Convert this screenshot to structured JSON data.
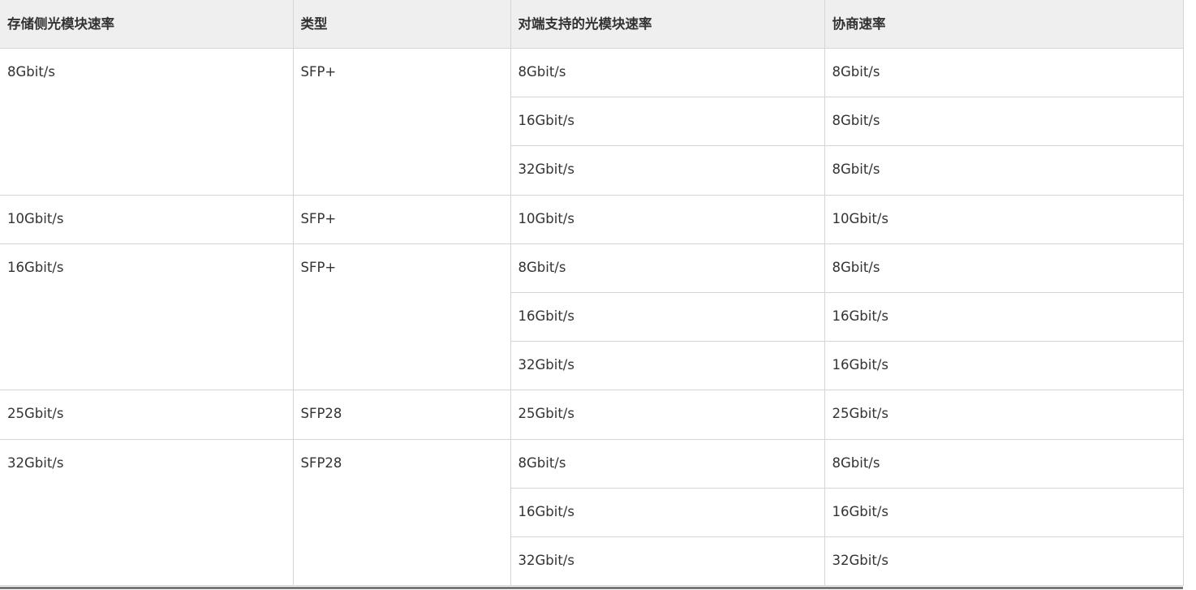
{
  "table": {
    "headers": [
      "存储侧光模块速率",
      "类型",
      "对端支持的光模块速率",
      "协商速率"
    ],
    "groups": [
      {
        "storage_rate": "8Gbit/s",
        "type": "SFP+",
        "rows": [
          {
            "peer_rate": "8Gbit/s",
            "negotiated": "8Gbit/s"
          },
          {
            "peer_rate": "16Gbit/s",
            "negotiated": "8Gbit/s"
          },
          {
            "peer_rate": "32Gbit/s",
            "negotiated": "8Gbit/s"
          }
        ]
      },
      {
        "storage_rate": "10Gbit/s",
        "type": "SFP+",
        "rows": [
          {
            "peer_rate": "10Gbit/s",
            "negotiated": "10Gbit/s"
          }
        ]
      },
      {
        "storage_rate": "16Gbit/s",
        "type": "SFP+",
        "rows": [
          {
            "peer_rate": "8Gbit/s",
            "negotiated": "8Gbit/s"
          },
          {
            "peer_rate": "16Gbit/s",
            "negotiated": "16Gbit/s"
          },
          {
            "peer_rate": "32Gbit/s",
            "negotiated": "16Gbit/s"
          }
        ]
      },
      {
        "storage_rate": "25Gbit/s",
        "type": "SFP28",
        "rows": [
          {
            "peer_rate": "25Gbit/s",
            "negotiated": "25Gbit/s"
          }
        ]
      },
      {
        "storage_rate": "32Gbit/s",
        "type": "SFP28",
        "rows": [
          {
            "peer_rate": "8Gbit/s",
            "negotiated": "8Gbit/s"
          },
          {
            "peer_rate": "16Gbit/s",
            "negotiated": "16Gbit/s"
          },
          {
            "peer_rate": "32Gbit/s",
            "negotiated": "32Gbit/s"
          }
        ]
      }
    ]
  }
}
